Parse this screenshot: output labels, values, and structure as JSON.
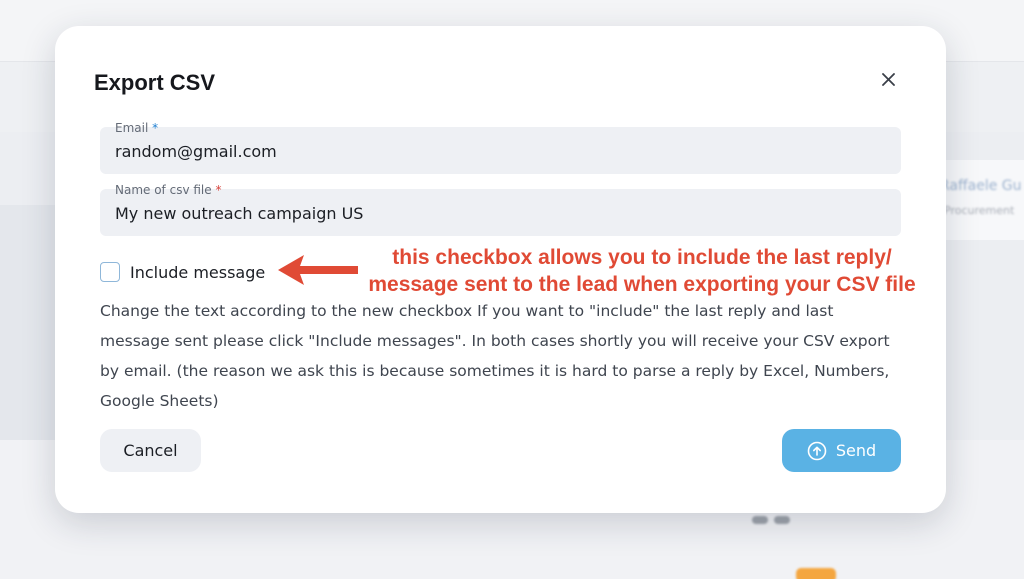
{
  "background": {
    "right_card_name": "Raffaele Gu",
    "right_card_sub": "Procurement"
  },
  "modal": {
    "title": "Export CSV",
    "close_icon": "close-icon",
    "email_field": {
      "label": "Email",
      "required_mark": "*",
      "value": "random@gmail.com"
    },
    "csv_field": {
      "label": "Name of csv file",
      "required_mark": "*",
      "value": "My new outreach campaign US"
    },
    "include_checkbox": {
      "label": "Include message",
      "checked": false
    },
    "description": "Change the text according to the new checkbox If you want to \"include\" the last reply and last message sent please click \"Include messages\". In both cases shortly you will receive your CSV export by email. (the reason we ask this is because sometimes it is hard to parse a reply by Excel, Numbers, Google Sheets)",
    "cancel_label": "Cancel",
    "send_label": "Send",
    "send_icon": "upload-circle-icon"
  },
  "annotation": {
    "line1": "this checkbox allows you to include the last reply/",
    "line2": "message sent to the lead when exporting your CSV file",
    "color": "#e04a35"
  },
  "colors": {
    "accent": "#5ab2e4",
    "required_blue": "#1f7fd1",
    "required_red": "#d6413a"
  }
}
